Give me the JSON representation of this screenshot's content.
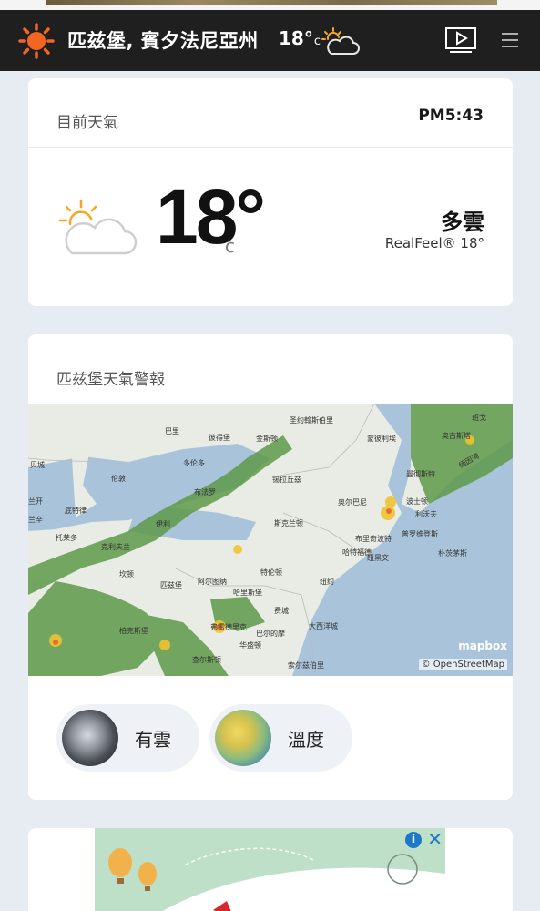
{
  "header": {
    "city": "匹兹堡, 賓夕法尼亞州",
    "temp": "18°",
    "temp_unit": "c",
    "weather_icon": "partly-cloudy-icon",
    "video_icon": "video-play-icon",
    "menu_icon": "hamburger-menu-icon",
    "logo_icon": "sun-logo-icon",
    "brand_color": "#f26522"
  },
  "current": {
    "title": "目前天氣",
    "time": "PM5:43",
    "temp": "18°",
    "unit": "c",
    "condition": "多雲",
    "realfeel": "RealFeel® 18°",
    "icon": "partly-cloudy-icon"
  },
  "alerts": {
    "title": "匹兹堡天氣警報",
    "map_attribution": "© OpenStreetMap",
    "map_brand": "mapbox",
    "map_labels": [
      "巴里",
      "彼得堡",
      "金斯顿",
      "圣约翰斯伯里",
      "奥古斯塔",
      "班戈",
      "波士顿",
      "普罗维登斯",
      "哈特福德",
      "纽约",
      "费城",
      "多伦多",
      "布法罗",
      "锡拉丘兹",
      "奥尔巴尼",
      "伊利",
      "克利夫兰",
      "哥伦布",
      "匹兹堡",
      "阿尔图纳",
      "哈里斯堡",
      "巴尔的摩",
      "华盛顿",
      "查尔斯顿",
      "朴茨茅斯",
      "缅因湾",
      "伦敦",
      "底特律",
      "托莱多",
      "贝城",
      "兰辛",
      "斯克兰顿",
      "布里奇波特",
      "特伦顿",
      "大西洋城",
      "纽黑文",
      "蒙彼利埃",
      "利沃夫",
      "弗吉尼亚比奇",
      "曼彻斯特"
    ],
    "chips": [
      {
        "label": "有雲",
        "icon": "cloud-satellite-thumbnail"
      },
      {
        "label": "溫度",
        "icon": "temperature-map-thumbnail"
      }
    ]
  },
  "ad": {
    "info_label": "i",
    "close_label": "✕"
  }
}
